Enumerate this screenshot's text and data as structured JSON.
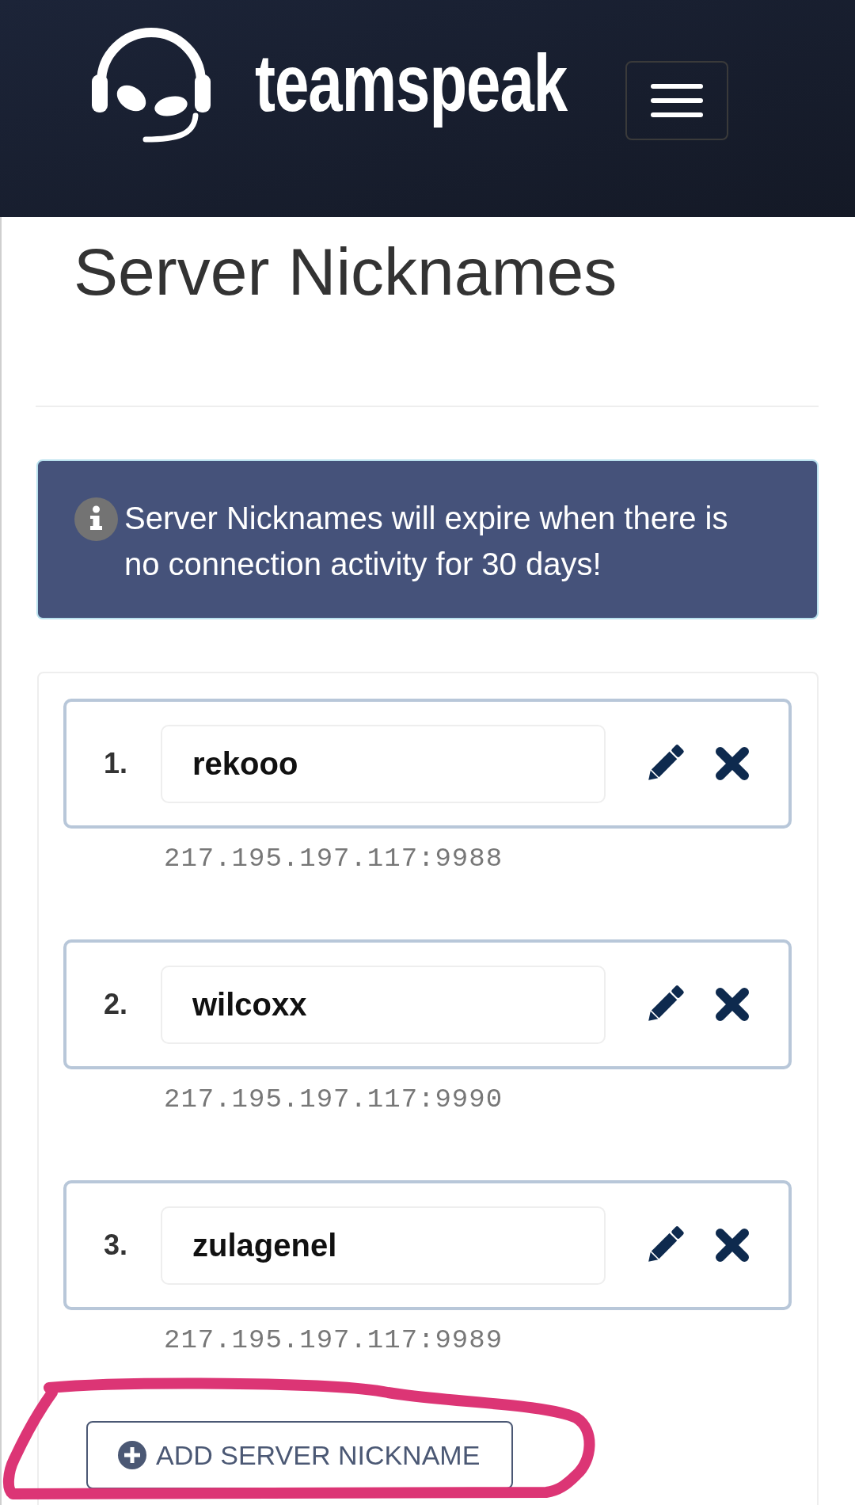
{
  "header": {
    "logo_text": "teamspeak"
  },
  "page_title": "Server Nicknames",
  "notice": {
    "text": "Server Nicknames will expire when there is no connection activity for 30 days!"
  },
  "nicknames": [
    {
      "number": "1.",
      "name": "rekooo",
      "address": "217.195.197.117:9988"
    },
    {
      "number": "2.",
      "name": "wilcoxx",
      "address": "217.195.197.117:9990"
    },
    {
      "number": "3.",
      "name": "zulagenel",
      "address": "217.195.197.117:9989"
    }
  ],
  "add_button": {
    "label": "ADD SERVER NICKNAME"
  }
}
